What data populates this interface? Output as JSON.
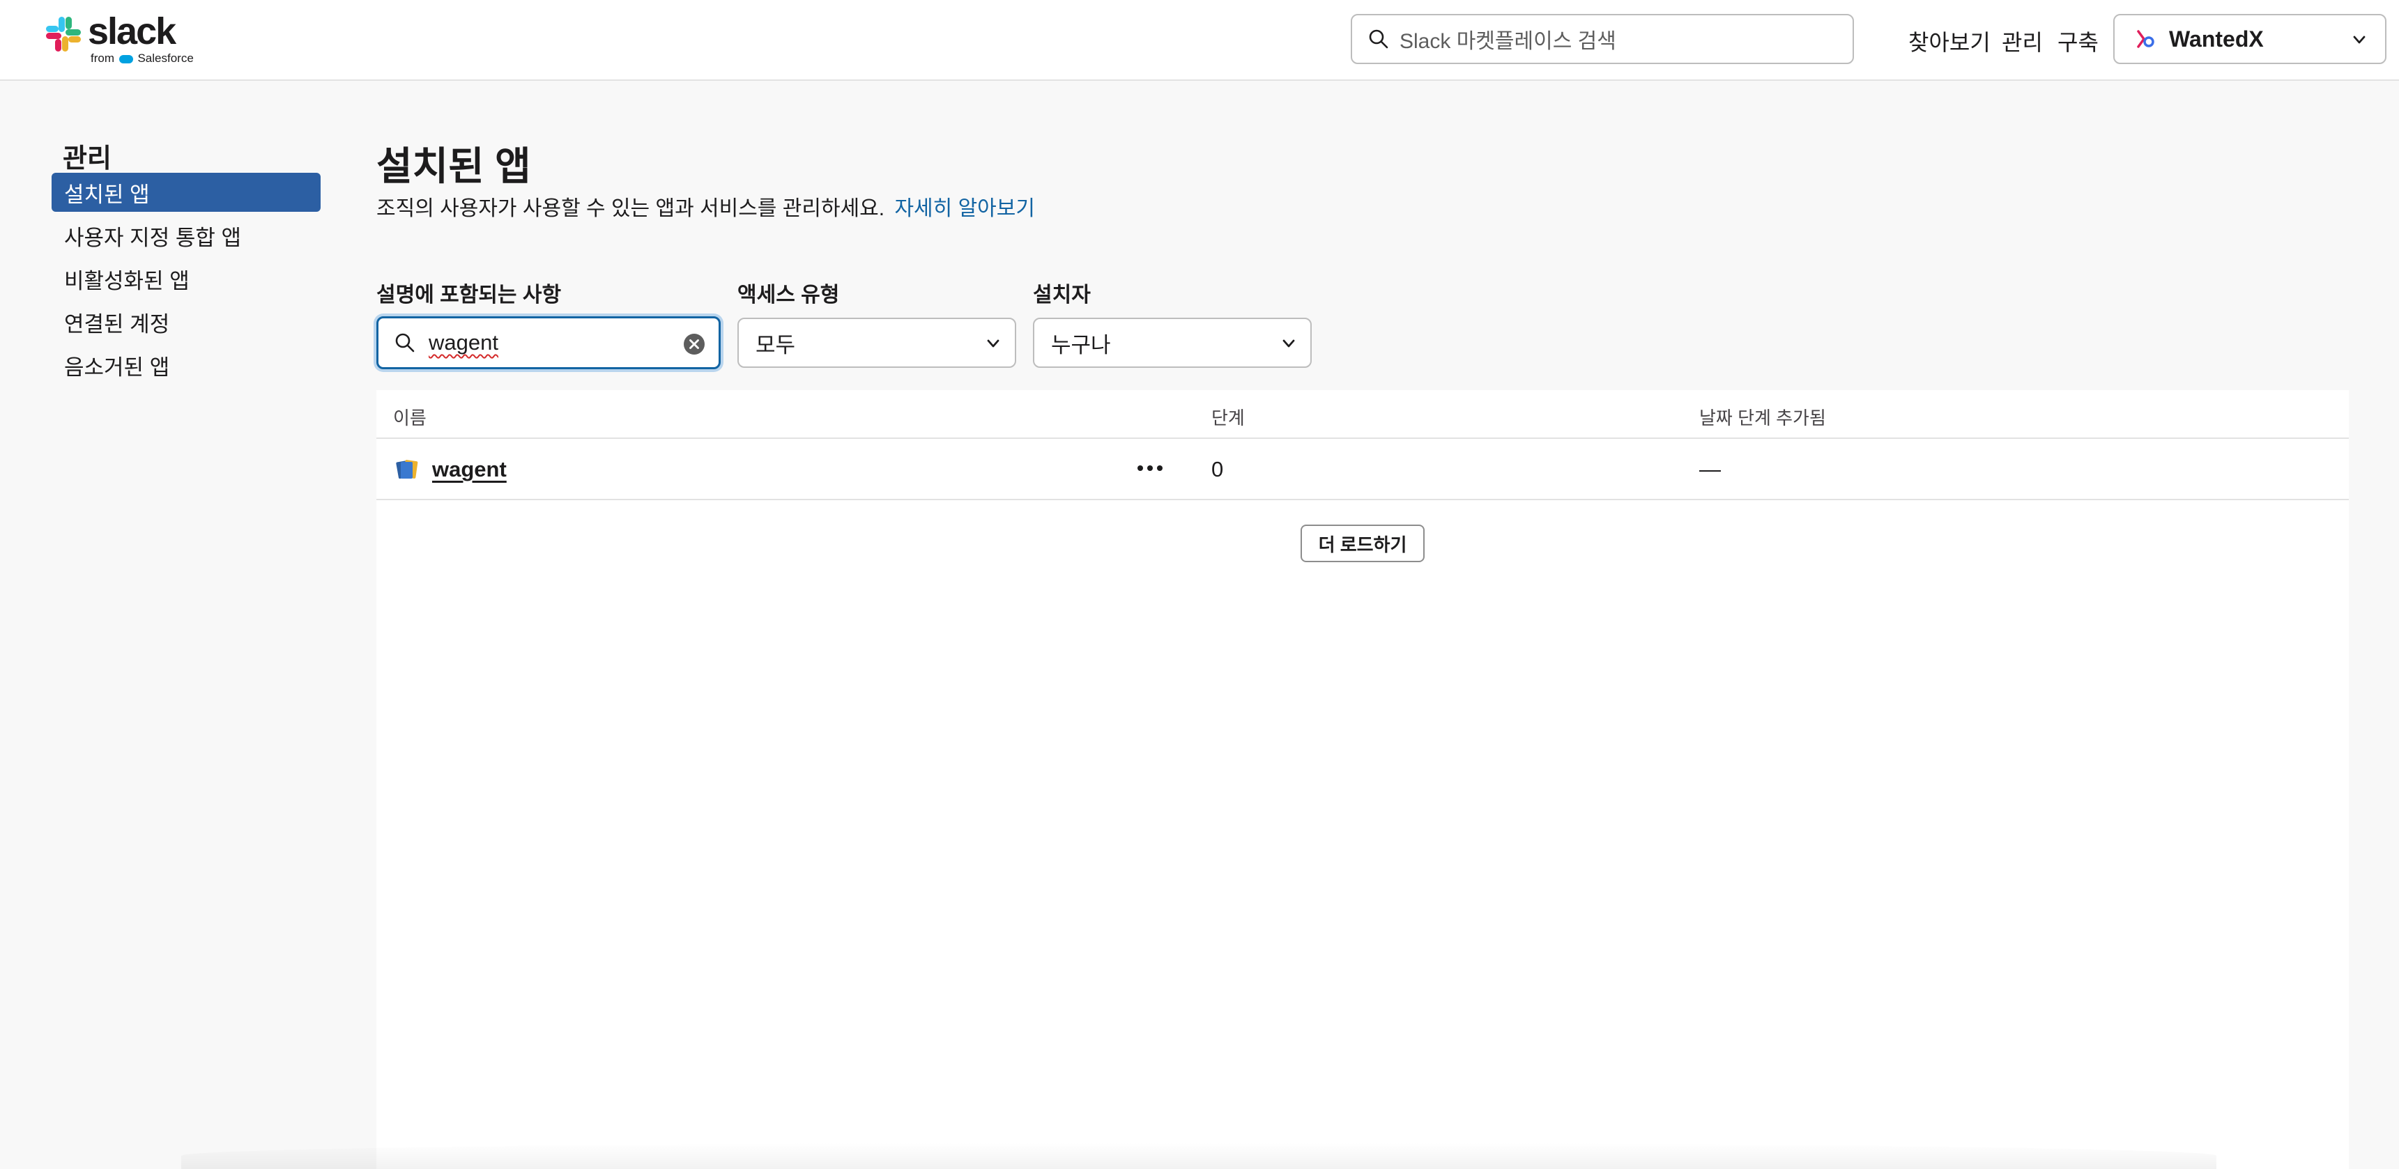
{
  "brand": {
    "name": "slack",
    "tagline_from": "from",
    "tagline_company": "Salesforce"
  },
  "topbar": {
    "search_placeholder": "Slack 마켓플레이스 검색",
    "nav": [
      "찾아보기",
      "관리",
      "구축"
    ],
    "workspace_name": "WantedX"
  },
  "sidebar": {
    "heading": "관리",
    "items": [
      {
        "label": "설치된 앱",
        "active": true
      },
      {
        "label": "사용자 지정 통합 앱",
        "active": false
      },
      {
        "label": "비활성화된 앱",
        "active": false
      },
      {
        "label": "연결된 계정",
        "active": false
      },
      {
        "label": "음소거된 앱",
        "active": false
      }
    ]
  },
  "main": {
    "title": "설치된 앱",
    "description": "조직의 사용자가 사용할 수 있는 앱과 서비스를 관리하세요.",
    "learn_more": "자세히 알아보기",
    "filters": {
      "search_label": "설명에 포함되는 사항",
      "search_value": "wagent",
      "access_label": "액세스 유형",
      "access_value": "모두",
      "installer_label": "설치자",
      "installer_value": "누구나"
    },
    "table": {
      "columns": [
        "이름",
        "단계",
        "날짜 단계 추가됨"
      ],
      "rows": [
        {
          "name": "wagent",
          "stage": "0",
          "date": "—"
        }
      ]
    },
    "load_more": "더 로드하기"
  },
  "colors": {
    "accent": "#2c5fa3",
    "link": "#1264a3",
    "background": "#f8f8f8"
  }
}
